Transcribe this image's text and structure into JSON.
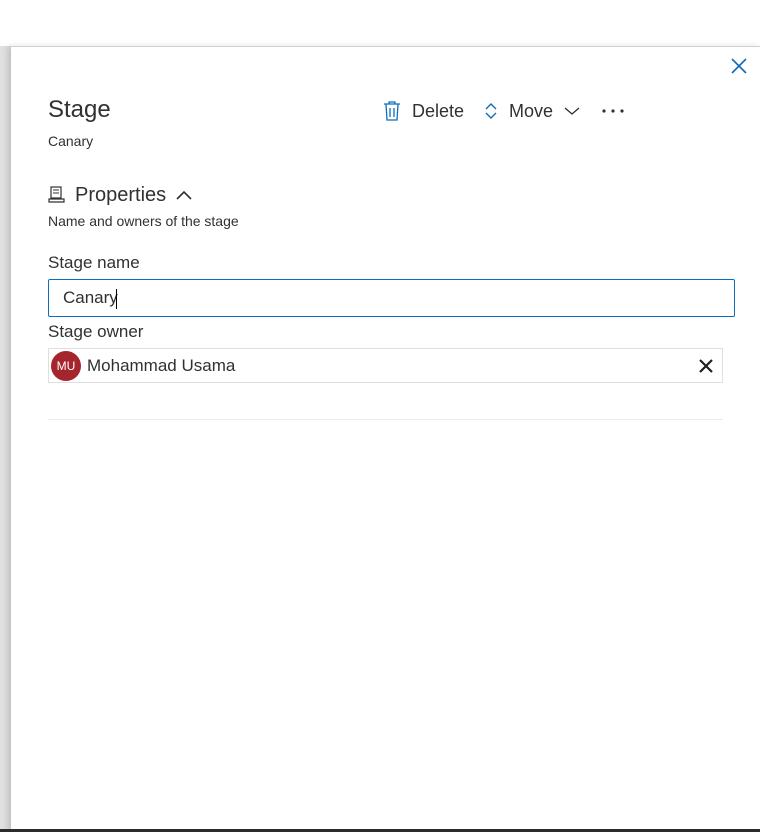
{
  "panel": {
    "title": "Stage",
    "subtitle": "Canary",
    "close_icon": "close-icon"
  },
  "commands": {
    "delete_label": "Delete",
    "move_label": "Move",
    "more_label": "···"
  },
  "properties": {
    "header": "Properties",
    "description": "Name and owners of the stage"
  },
  "form": {
    "stage_name_label": "Stage name",
    "stage_name_value": "Canary",
    "stage_owner_label": "Stage owner",
    "owner_initials": "MU",
    "owner_name": "Mohammad Usama"
  },
  "colors": {
    "accent": "#0f6cbd",
    "avatar_bg": "#a4262c"
  }
}
